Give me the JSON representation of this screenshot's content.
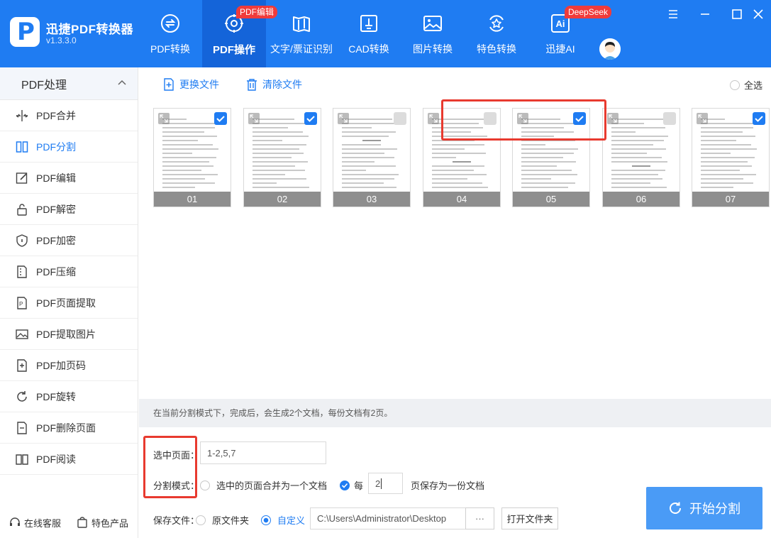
{
  "app": {
    "title": "迅捷PDF转换器",
    "version": "v1.3.3.0",
    "brand_color": "#1f7cf2",
    "logo_letter": "P"
  },
  "nav": {
    "tabs": [
      {
        "label": "PDF转换",
        "icon": "pdf-convert-icon",
        "active": false
      },
      {
        "label": "PDF操作",
        "icon": "pdf-operate-icon",
        "active": true,
        "badge": "PDF编辑"
      },
      {
        "label": "文字/票证识别",
        "icon": "ocr-icon",
        "active": false
      },
      {
        "label": "CAD转换",
        "icon": "cad-icon",
        "active": false
      },
      {
        "label": "图片转换",
        "icon": "image-icon",
        "active": false
      },
      {
        "label": "特色转换",
        "icon": "star-icon",
        "active": false
      },
      {
        "label": "迅捷AI",
        "icon": "ai-icon",
        "active": false,
        "badge": "DeepSeek",
        "icon_text": "Ai"
      }
    ]
  },
  "sidebar": {
    "section_title": "PDF处理",
    "items": [
      {
        "label": "PDF合并",
        "icon": "merge-icon"
      },
      {
        "label": "PDF分割",
        "icon": "split-icon",
        "active": true
      },
      {
        "label": "PDF编辑",
        "icon": "edit-icon"
      },
      {
        "label": "PDF解密",
        "icon": "unlock-icon"
      },
      {
        "label": "PDF加密",
        "icon": "shield-icon"
      },
      {
        "label": "PDF压缩",
        "icon": "compress-icon"
      },
      {
        "label": "PDF页面提取",
        "icon": "page-extract-icon"
      },
      {
        "label": "PDF提取图片",
        "icon": "image-extract-icon"
      },
      {
        "label": "PDF加页码",
        "icon": "page-number-icon"
      },
      {
        "label": "PDF旋转",
        "icon": "rotate-icon"
      },
      {
        "label": "PDF删除页面",
        "icon": "delete-page-icon"
      },
      {
        "label": "PDF阅读",
        "icon": "book-icon"
      }
    ],
    "footer": {
      "service": "在线客服",
      "products": "特色产品"
    }
  },
  "toolbar": {
    "replace_file": "更换文件",
    "clear_file": "清除文件",
    "select_all": "全选"
  },
  "pages": [
    {
      "num": "01",
      "checked": true
    },
    {
      "num": "02",
      "checked": true
    },
    {
      "num": "03",
      "checked": false
    },
    {
      "num": "04",
      "checked": false
    },
    {
      "num": "05",
      "checked": true
    },
    {
      "num": "06",
      "checked": false
    },
    {
      "num": "07",
      "checked": true
    }
  ],
  "info": "在当前分割模式下，完成后，会生成2个文档，每份文档有2页。",
  "form": {
    "selected_pages_label": "选中页面：",
    "selected_pages_value": "1-2,5,7",
    "split_mode_label": "分割模式：",
    "mode_merge": "选中的页面合并为一个文档",
    "mode_every_prefix": "每",
    "mode_every_value": "2",
    "mode_every_suffix": "页保存为一份文档",
    "save_label": "保存文件：",
    "save_original": "原文件夹",
    "save_custom": "自定义",
    "save_path": "C:\\Users\\Administrator\\Desktop",
    "browse": "···",
    "open_folder": "打开文件夹",
    "start": "开始分割"
  }
}
